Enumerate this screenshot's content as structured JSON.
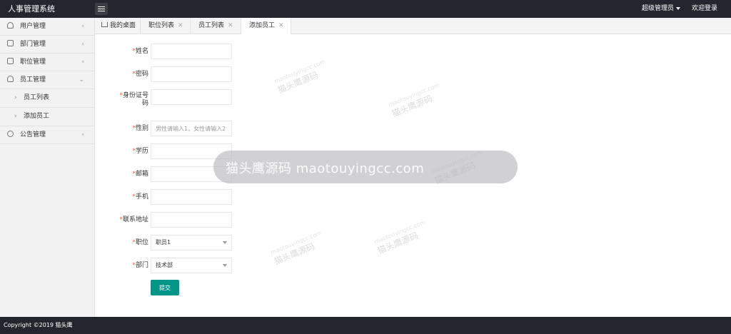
{
  "header": {
    "app_title": "人事管理系统",
    "user_menu": "超级管理员",
    "welcome_link": "欢迎登录"
  },
  "sidebar": {
    "items": [
      {
        "label": "用户管理",
        "icon": "user-icon"
      },
      {
        "label": "部门管理",
        "icon": "department-icon"
      },
      {
        "label": "职位管理",
        "icon": "position-icon"
      },
      {
        "label": "员工管理",
        "icon": "employees-icon",
        "expanded": true,
        "children": [
          {
            "label": "员工列表"
          },
          {
            "label": "添加员工"
          }
        ]
      },
      {
        "label": "公告管理",
        "icon": "announcement-icon"
      }
    ]
  },
  "tabs": [
    {
      "label": "我的桌面",
      "closable": false
    },
    {
      "label": "职位列表",
      "closable": true
    },
    {
      "label": "员工列表",
      "closable": true
    },
    {
      "label": "添加员工",
      "closable": true,
      "active": true
    }
  ],
  "form": {
    "required_mark": "*",
    "fields": {
      "name": {
        "label": "姓名",
        "value": ""
      },
      "password": {
        "label": "密码",
        "value": ""
      },
      "id_number": {
        "label": "身份证号码",
        "value": ""
      },
      "gender": {
        "label": "性别",
        "value": "",
        "placeholder": "男性请输入1，女性请输入2"
      },
      "education": {
        "label": "学历",
        "value": ""
      },
      "email": {
        "label": "邮箱",
        "value": ""
      },
      "phone": {
        "label": "手机",
        "value": ""
      },
      "address": {
        "label": "联系地址",
        "value": ""
      },
      "position": {
        "label": "职位",
        "selected": "职员1"
      },
      "department": {
        "label": "部门",
        "selected": "技术部"
      }
    },
    "submit_label": "提交"
  },
  "watermark": {
    "main": "猫头鹰源码 maotouyingcc.com",
    "small_cn": "猫头鹰源码",
    "small_en": "maotouyingcc.com"
  },
  "footer": {
    "copyright": "Copyright ©2019 猫头鹰"
  },
  "colors": {
    "header_bg": "#23262e",
    "accent": "#009688",
    "required": "#ff5722"
  }
}
